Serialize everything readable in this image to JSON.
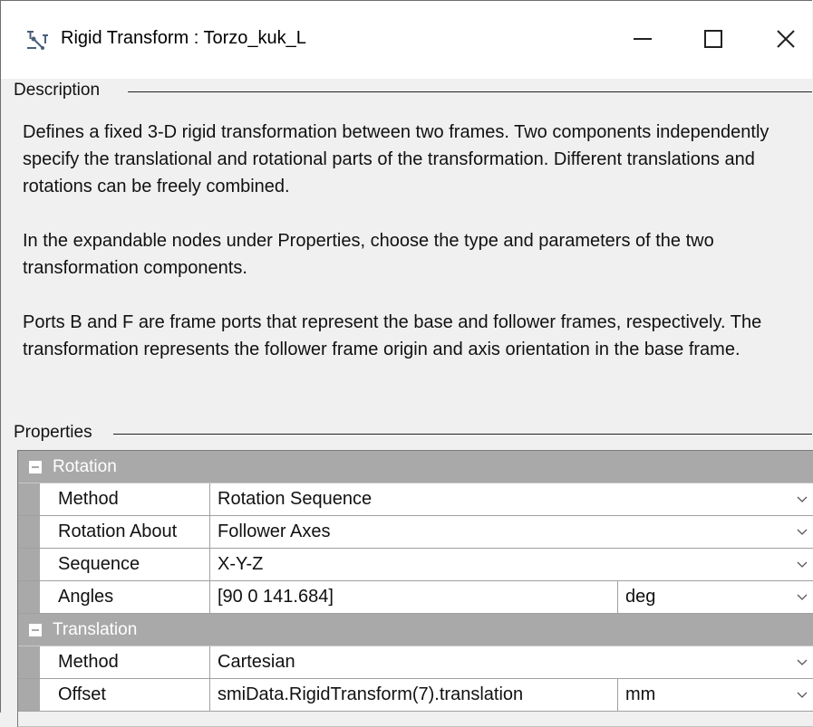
{
  "window": {
    "title": "Rigid Transform : Torzo_kuk_L",
    "minimize_icon": "minimize-icon",
    "maximize_icon": "maximize-icon",
    "close_icon": "close-icon"
  },
  "description": {
    "label": "Description",
    "paragraphs": [
      "Defines a fixed 3-D rigid transformation between two frames. Two components independently specify the translational and rotational parts of the transformation. Different translations and rotations can be freely combined.",
      "In the expandable nodes under Properties, choose the type and parameters of the two transformation components.",
      "Ports B and F are frame ports that represent the base and follower frames, respectively. The transformation represents the follower frame origin and axis orientation in the base frame."
    ]
  },
  "properties": {
    "label": "Properties",
    "rotation": {
      "label": "Rotation",
      "rows": [
        {
          "name": "Method",
          "value": "Rotation Sequence"
        },
        {
          "name": "Rotation About",
          "value": "Follower Axes"
        },
        {
          "name": "Sequence",
          "value": "X-Y-Z"
        },
        {
          "name": "Angles",
          "value": "[90 0 141.684]",
          "unit": "deg"
        }
      ]
    },
    "translation": {
      "label": "Translation",
      "rows": [
        {
          "name": "Method",
          "value": "Cartesian"
        },
        {
          "name": "Offset",
          "value": "smiData.RigidTransform(7).translation",
          "unit": "mm"
        }
      ]
    }
  },
  "colors": {
    "category_header": "#a9a9a9",
    "window_bg": "#f0f0f0",
    "titlebar_bg": "#ffffff"
  }
}
